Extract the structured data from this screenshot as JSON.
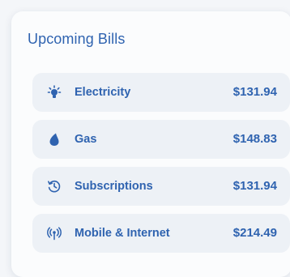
{
  "card": {
    "title": "Upcoming Bills"
  },
  "bills": [
    {
      "name": "Electricity",
      "amount": "$131.94",
      "icon": "lightbulb-icon"
    },
    {
      "name": "Gas",
      "amount": "$148.83",
      "icon": "flame-drop-icon"
    },
    {
      "name": "Subscriptions",
      "amount": "$131.94",
      "icon": "history-icon"
    },
    {
      "name": "Mobile & Internet",
      "amount": "$214.49",
      "icon": "broadcast-signal-icon"
    }
  ],
  "colors": {
    "accent": "#2f63b0",
    "item_background": "#edf1f6",
    "card_background": "#fbfcfd"
  }
}
